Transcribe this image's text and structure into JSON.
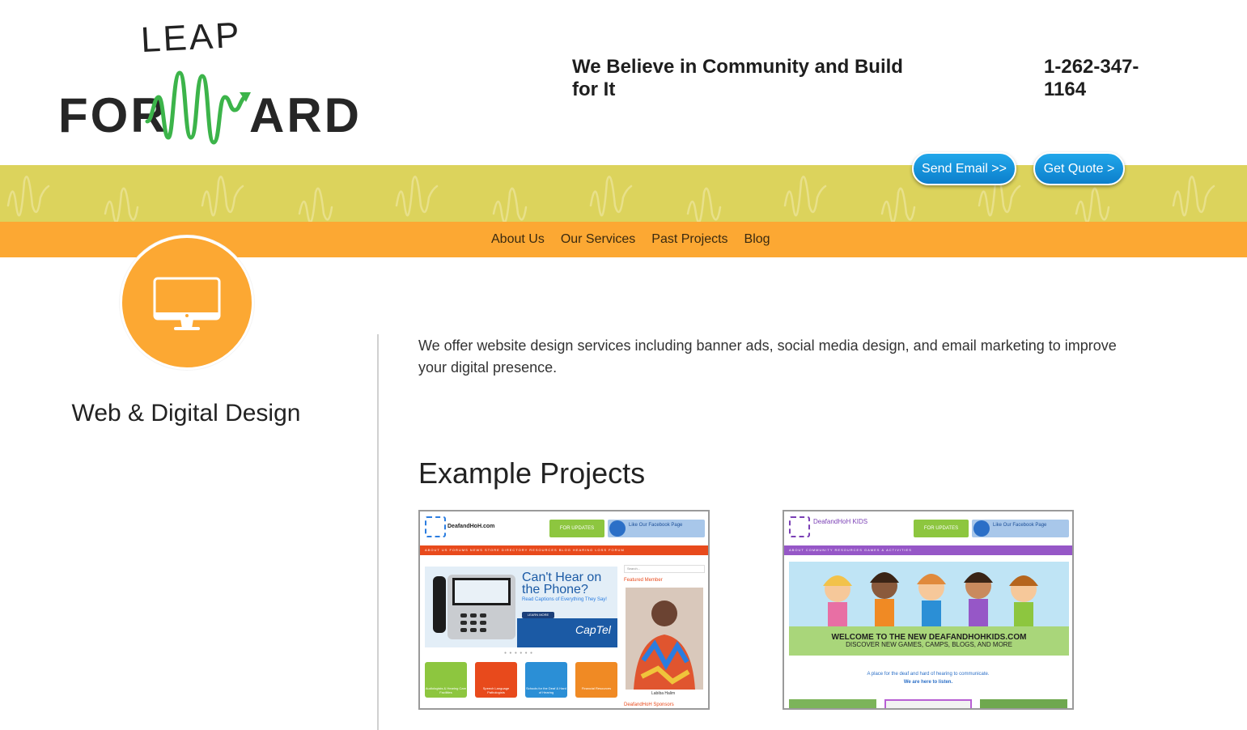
{
  "brand": {
    "logo_top": "LEAP",
    "logo_left": "FOR",
    "logo_right": "ARD",
    "colors": {
      "yellow": "#dcd35c",
      "orange": "#fca833",
      "green": "#3cb44a",
      "blue": "#1490dd"
    }
  },
  "header": {
    "tagline": "We Believe in Community and Build for It",
    "phone": "1-262-347-1164",
    "send_email": "Send Email >>",
    "get_quote": "Get Quote >"
  },
  "nav": {
    "items": [
      "About Us",
      "Our Services",
      "Past Projects",
      "Blog"
    ]
  },
  "service": {
    "icon": "desktop-monitor-icon",
    "title": "Web & Digital Design",
    "description": "We offer website design services including banner ads, social media design, and email marketing to improve your digital presence."
  },
  "projects": {
    "heading": "Example Projects",
    "items": [
      {
        "site": "DeafandHoH.com",
        "updates": "FOR UPDATES",
        "facebook": "Like Our Facebook Page",
        "nav": "ABOUT US   FORUMS   NEWS   STORE   DIRECTORY   RESOURCES   BLOG   HEARING LOSS FORUM",
        "hero_title": "Can't Hear on the Phone?",
        "hero_sub": "Read Captions of Everything They Say!",
        "learn_more": "LEARN MORE",
        "captel": "CapTel",
        "search": "Search...",
        "featured": "Featured Member",
        "member": "Labiba Halim",
        "sponsors": "DeafandHoH Sponsors",
        "tiles": [
          "Audiologists & Hearing Care Facilities",
          "Speech Language Pathologists",
          "Schools for the Deaf & Hard of Hearing",
          "Financial Resources"
        ]
      },
      {
        "site": "DeafandHoH KIDS",
        "updates": "FOR UPDATES",
        "facebook": "Like Our Facebook Page",
        "nav": "ABOUT   COMMUNITY   RESOURCES   GAMES & ACTIVITIES",
        "caption1": "WELCOME TO THE NEW DEAFANDHOHKIDS.COM",
        "caption2": "DISCOVER NEW GAMES, CAMPS, BLOGS, AND MORE",
        "tag1": "A place for the deaf and hard of hearing to communicate.",
        "tag2": "We are here to listen."
      }
    ]
  }
}
